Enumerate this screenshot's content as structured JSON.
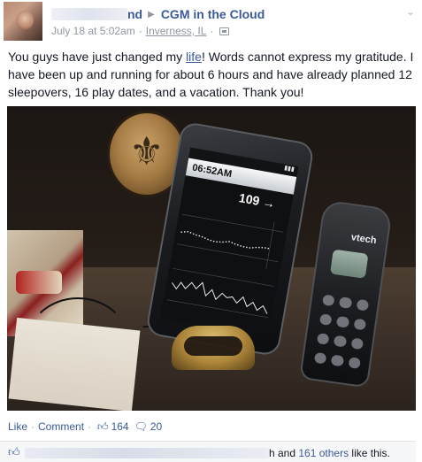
{
  "post": {
    "author_suffix": "nd",
    "group": "CGM in the Cloud",
    "timestamp": "July 18 at 5:02am",
    "location": "Inverness, IL",
    "text_before_link": "You guys have just changed my ",
    "text_link": "life",
    "text_after_link": "! Words cannot express my gratitude. I have been up and running for about 6 hours and have already planned 12 sleepovers, 16 play dates, and a vacation. Thank you!"
  },
  "photo": {
    "tablet_time": "06:52AM",
    "tablet_value": "109 →",
    "phone_brand": "vtech"
  },
  "actions": {
    "like": "Like",
    "comment": "Comment",
    "like_count": "164",
    "comment_count": "20"
  },
  "likes": {
    "name_suffix": "h and ",
    "others": "161 others",
    "tail": " like this."
  },
  "icons": {
    "arrow": "triangle-right-icon",
    "chevron": "chevron-down-icon",
    "thumb": "thumbs-up-icon",
    "comment": "comment-bubble-icon"
  }
}
